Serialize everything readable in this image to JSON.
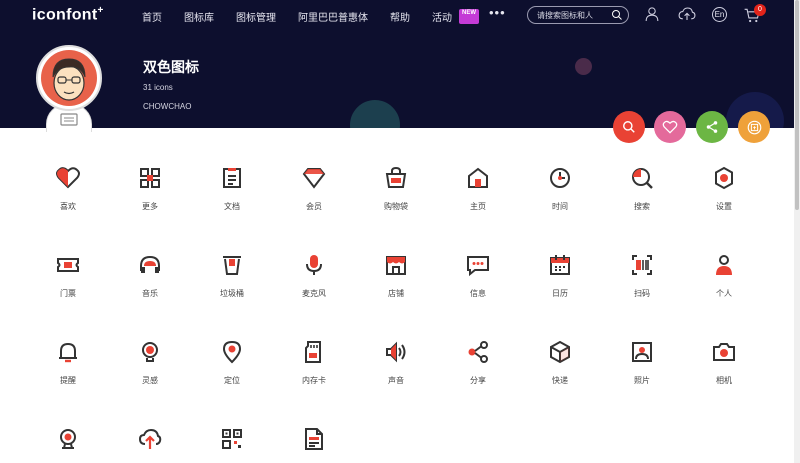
{
  "header": {
    "logo": "iconfont",
    "logo_mark": "+",
    "nav": [
      "首页",
      "图标库",
      "图标管理",
      "阿里巴巴普惠体",
      "帮助",
      "活动"
    ],
    "new_badge": "NEW",
    "more": "•••",
    "search_placeholder": "请搜索图标和人",
    "lang": "En",
    "cart_count": "0"
  },
  "project": {
    "title": "双色图标",
    "count": "31 icons",
    "author": "CHOWCHAO"
  },
  "colors": {
    "primary": "#333333",
    "accent": "#e94234"
  },
  "icons": [
    {
      "label": "喜欢",
      "icon": "heart-icon"
    },
    {
      "label": "更多",
      "icon": "grid-more-icon"
    },
    {
      "label": "文档",
      "icon": "document-icon"
    },
    {
      "label": "会员",
      "icon": "diamond-icon"
    },
    {
      "label": "购物袋",
      "icon": "shopping-bag-icon"
    },
    {
      "label": "主页",
      "icon": "home-icon"
    },
    {
      "label": "时间",
      "icon": "clock-icon"
    },
    {
      "label": "搜索",
      "icon": "search-icon"
    },
    {
      "label": "设置",
      "icon": "settings-icon"
    },
    {
      "label": "门票",
      "icon": "ticket-icon"
    },
    {
      "label": "音乐",
      "icon": "headphones-icon"
    },
    {
      "label": "垃圾桶",
      "icon": "trash-icon"
    },
    {
      "label": "麦克风",
      "icon": "microphone-icon"
    },
    {
      "label": "店铺",
      "icon": "shop-icon"
    },
    {
      "label": "信息",
      "icon": "message-icon"
    },
    {
      "label": "日历",
      "icon": "calendar-icon"
    },
    {
      "label": "扫码",
      "icon": "scan-icon"
    },
    {
      "label": "个人",
      "icon": "person-icon"
    },
    {
      "label": "提醒",
      "icon": "bell-icon"
    },
    {
      "label": "灵感",
      "icon": "lightbulb-icon"
    },
    {
      "label": "定位",
      "icon": "location-icon"
    },
    {
      "label": "内存卡",
      "icon": "memory-card-icon"
    },
    {
      "label": "声音",
      "icon": "speaker-icon"
    },
    {
      "label": "分享",
      "icon": "share-icon"
    },
    {
      "label": "快递",
      "icon": "package-icon"
    },
    {
      "label": "照片",
      "icon": "photo-icon"
    },
    {
      "label": "相机",
      "icon": "camera-icon"
    },
    {
      "label": "",
      "icon": "webcam-icon"
    },
    {
      "label": "",
      "icon": "cloud-upload-icon"
    },
    {
      "label": "",
      "icon": "qrcode-icon"
    },
    {
      "label": "",
      "icon": "file-icon"
    }
  ]
}
